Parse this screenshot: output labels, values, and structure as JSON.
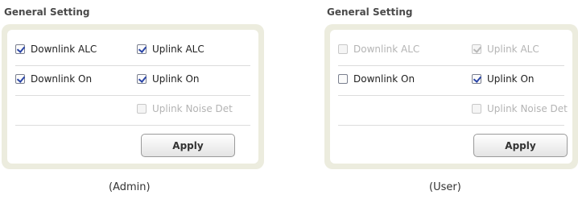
{
  "panels": [
    {
      "title": "General Setting",
      "caption": "(Admin)",
      "downlink_alc": {
        "label": "Downlink ALC",
        "checked": true,
        "enabled": true
      },
      "uplink_alc": {
        "label": "Uplink ALC",
        "checked": true,
        "enabled": true
      },
      "downlink_on": {
        "label": "Downlink On",
        "checked": true,
        "enabled": true
      },
      "uplink_on": {
        "label": "Uplink On",
        "checked": true,
        "enabled": true
      },
      "uplink_noise_det": {
        "label": "Uplink Noise Det",
        "checked": false,
        "enabled": false
      },
      "apply_label": "Apply"
    },
    {
      "title": "General Setting",
      "caption": "(User)",
      "downlink_alc": {
        "label": "Downlink ALC",
        "checked": false,
        "enabled": false
      },
      "uplink_alc": {
        "label": "Uplink ALC",
        "checked": true,
        "enabled": false
      },
      "downlink_on": {
        "label": "Downlink On",
        "checked": false,
        "enabled": true
      },
      "uplink_on": {
        "label": "Uplink On",
        "checked": true,
        "enabled": true
      },
      "uplink_noise_det": {
        "label": "Uplink Noise Det",
        "checked": false,
        "enabled": false
      },
      "apply_label": "Apply"
    }
  ],
  "colors": {
    "frame": "#ececde",
    "check": "#2a45a8",
    "disabled_text": "#b4b4b4"
  },
  "icons": {
    "checkbox": "checkbox-icon"
  }
}
